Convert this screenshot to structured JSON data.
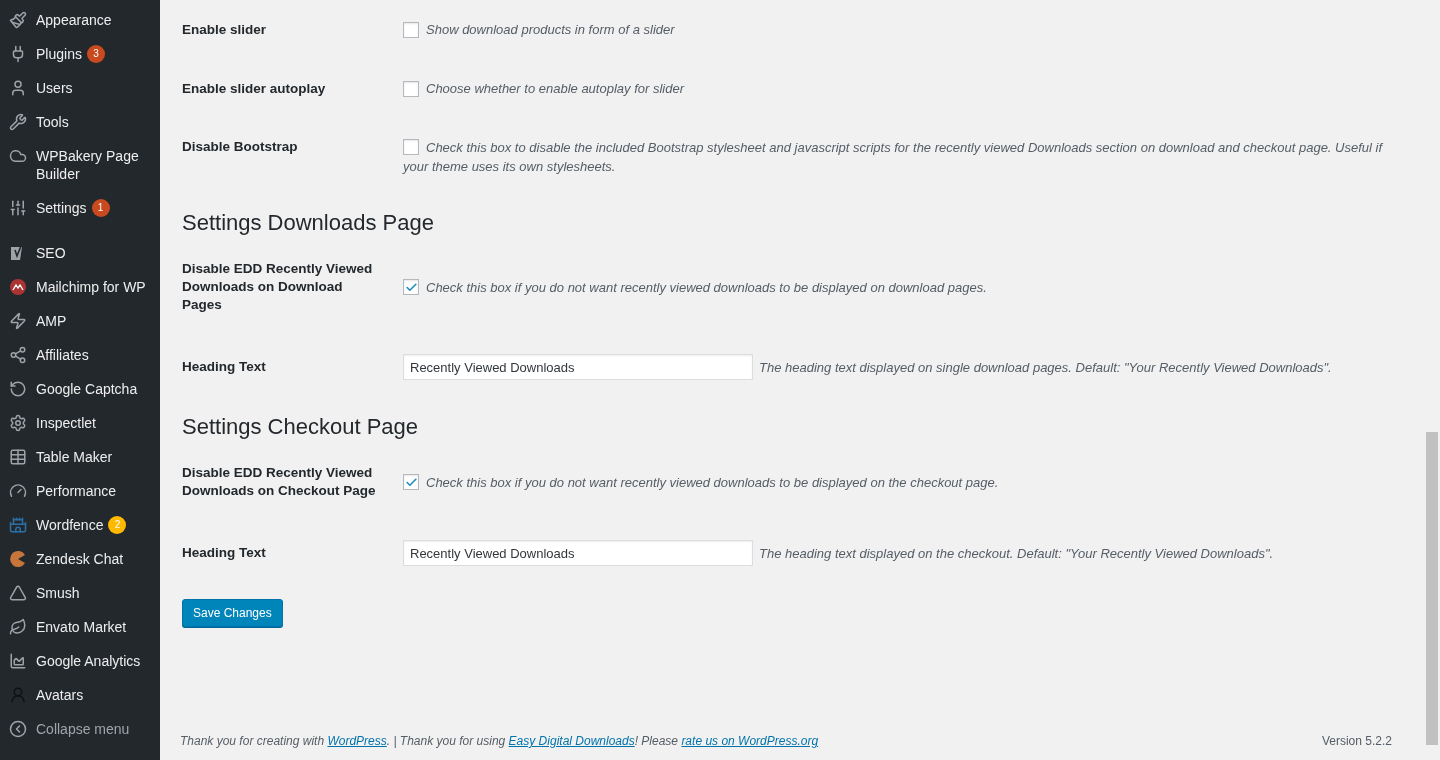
{
  "sidebar": {
    "groups": [
      {
        "items": [
          {
            "label": "Appearance"
          },
          {
            "label": "Plugins",
            "badge": "3",
            "color": "#ca4a1f"
          },
          {
            "label": "Users"
          },
          {
            "label": "Tools"
          },
          {
            "label": "WPBakery Page Builder"
          },
          {
            "label": "Settings",
            "badge": "1",
            "color": "#ca4a1f"
          }
        ]
      },
      {
        "items": [
          {
            "label": "SEO"
          },
          {
            "label": "Mailchimp for WP"
          },
          {
            "label": "AMP"
          },
          {
            "label": "Affiliates"
          },
          {
            "label": "Google Captcha"
          },
          {
            "label": "Inspectlet"
          },
          {
            "label": "Table Maker"
          },
          {
            "label": "Performance"
          },
          {
            "label": "Wordfence",
            "badge": "2",
            "color": "#ffb900"
          },
          {
            "label": "Zendesk Chat"
          },
          {
            "label": "Smush"
          },
          {
            "label": "Envato Market"
          },
          {
            "label": "Google Analytics"
          },
          {
            "label": "Avatars"
          }
        ]
      }
    ],
    "collapse": "Collapse menu"
  },
  "sections": [
    {
      "rows": [
        {
          "kind": "checkbox",
          "label": "Enable slider",
          "checked": false,
          "description": "Show download products in form of a slider"
        },
        {
          "kind": "checkbox",
          "label": "Enable slider autoplay",
          "checked": false,
          "description": "Choose whether to enable autoplay for slider"
        },
        {
          "kind": "checkbox",
          "label": "Disable Bootstrap",
          "checked": false,
          "description": "Check this box to disable the included Bootstrap stylesheet and javascript scripts for the recently viewed Downloads section on download and checkout page. Useful if your theme uses its own stylesheets."
        }
      ]
    },
    {
      "heading": "Settings Downloads Page",
      "rows": [
        {
          "kind": "checkbox",
          "label": "Disable EDD Recently Viewed Downloads on Download Pages",
          "checked": true,
          "description": "Check this box if you do not want recently viewed downloads to be displayed on download pages."
        },
        {
          "kind": "text",
          "label": "Heading Text",
          "value": "Recently Viewed Downloads",
          "description": "The heading text displayed on single download pages. Default: \"Your Recently Viewed Downloads\"."
        }
      ]
    },
    {
      "heading": "Settings Checkout Page",
      "rows": [
        {
          "kind": "checkbox",
          "label": "Disable EDD Recently Viewed Downloads on Checkout Page",
          "checked": true,
          "description": "Check this box if you do not want recently viewed downloads to be displayed on the checkout page."
        },
        {
          "kind": "text",
          "label": "Heading Text",
          "value": "Recently Viewed Downloads",
          "description": "The heading text displayed on the checkout. Default: \"Your Recently Viewed Downloads\"."
        }
      ]
    }
  ],
  "save_button": "Save Changes",
  "footer": {
    "credits": [
      {
        "text": "Thank you for creating with ",
        "kind": "text"
      },
      {
        "text": "WordPress",
        "kind": "link"
      },
      {
        "text": ". | Thank you for using ",
        "kind": "text"
      },
      {
        "text": "Easy Digital Downloads",
        "kind": "link"
      },
      {
        "text": "! Please ",
        "kind": "text"
      },
      {
        "text": "rate us on WordPress.org",
        "kind": "link"
      }
    ],
    "version": "Version 5.2.2"
  }
}
